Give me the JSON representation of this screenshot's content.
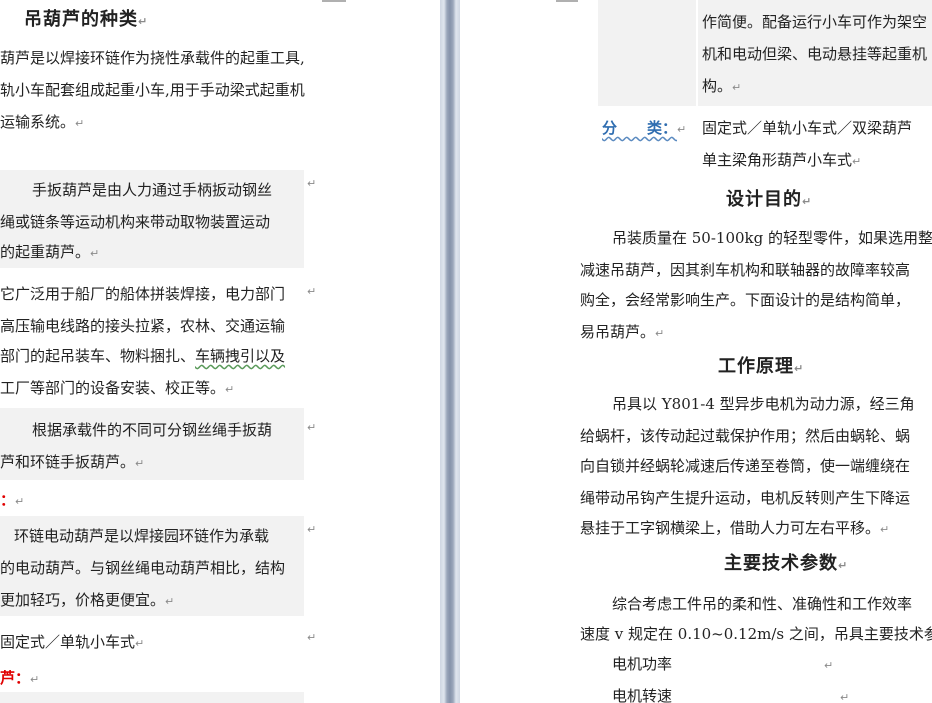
{
  "left": {
    "heading": "吊葫芦的种类",
    "intro": [
      "葫芦是以焊接环链作为挠性承载件的起重工具,",
      "轨小车配套组成起重小车,用于手动梁式起重机",
      "运输系统。"
    ],
    "box1": [
      "手扳葫芦是由人力通过手柄扳动钢丝",
      "绳或链条等运动机构来带动取物装置运动",
      "的起重葫芦。"
    ],
    "box2": [
      "它广泛用于船厂的船体拼装焊接，电力部门",
      "高压输电线路的接头拉紧，农林、交通运输",
      "部门的起吊装车、物料捆扎、",
      "车辆拽引以及",
      "工厂等部门的设备安装、校正等。"
    ],
    "box3": [
      "根据承载件的不同可分钢丝绳手扳葫",
      "芦和环链手扳葫芦。"
    ],
    "red1": "：",
    "box4": [
      "环链电动葫芦是以焊接园环链作为承载",
      "的电动葫芦。与钢丝绳电动葫芦相比，结构",
      "更加轻巧，价格更便宜。"
    ],
    "type_line": "固定式／单轨小车式",
    "red2": "芦："
  },
  "right": {
    "box_top": [
      "作简便。配备运行小车可作为架空",
      "机和电动但梁、电动悬挂等起重机",
      "构。"
    ],
    "class_label": "分　　类：",
    "class_lines": [
      "固定式／单轨小车式／双梁葫芦",
      "单主梁角形葫芦小车式"
    ],
    "h_purpose": "设计目的",
    "purpose": [
      "吊装质量在 50-100kg 的轻型零件，如果选用整",
      "减速吊葫芦，因其刹车机构和联轴器的故障率较高",
      "购全，会经常影响生产。下面设计的是结构简单，",
      "易吊葫芦。"
    ],
    "h_principle": "工作原理",
    "principle": [
      "吊具以 Y801-4 型异步电机为动力源，经三角",
      "给蜗杆，该传动起过载保护作用；然后由蜗轮、蜗",
      "向自锁并经蜗轮减速后传递至卷筒，使一端缠绕在",
      "绳带动吊钩产生提升运动，电机反转则产生下降运",
      "悬挂于工字钢横梁上，借助人力可左右平移。"
    ],
    "h_params": "主要技术参数",
    "params": [
      "综合考虑工件吊的柔和性、准确性和工作效率",
      "速度 v 规定在 0.10~0.12m/s 之间，吊具主要技术参"
    ],
    "param_items": [
      "电机功率",
      "电机转速"
    ]
  },
  "symbols": {
    "para_mark": "↵",
    "cell_mark": "↵"
  }
}
